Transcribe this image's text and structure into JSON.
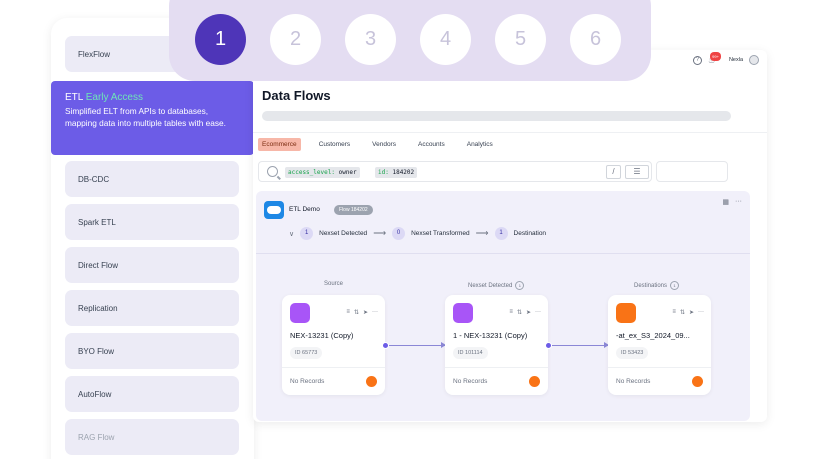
{
  "sidebar": {
    "items": [
      {
        "label": "FlexFlow"
      },
      {
        "label": "DB-CDC"
      },
      {
        "label": "Spark ETL"
      },
      {
        "label": "Direct Flow"
      },
      {
        "label": "Replication"
      },
      {
        "label": "BYO Flow"
      },
      {
        "label": "AutoFlow"
      },
      {
        "label": "RAG Flow"
      }
    ],
    "active": {
      "title": "ETL",
      "highlight": "Early Access",
      "description": "Simplified ELT from APIs to databases, mapping data into multiple tables with ease."
    }
  },
  "stepper": {
    "steps": [
      "1",
      "2",
      "3",
      "4",
      "5",
      "6"
    ],
    "active_index": 0
  },
  "topbar": {
    "user_name": "Nexla",
    "notification_count": "99+"
  },
  "page": {
    "title": "Data Flows",
    "tabs": [
      "Ecommerce",
      "Customers",
      "Vendors",
      "Accounts",
      "Analytics"
    ],
    "active_tab": "Ecommerce"
  },
  "search": {
    "chip1_key": "access_level:",
    "chip1_val": "owner",
    "chip2_key": "id:",
    "chip2_val": "184202",
    "slash": "/"
  },
  "flow": {
    "name": "ETL Demo",
    "badge": "Flow 184202",
    "stages": [
      {
        "count": "1",
        "label": "Nexset Detected"
      },
      {
        "count": "0",
        "label": "Nexset Transformed"
      },
      {
        "count": "1",
        "label": "Destination"
      }
    ],
    "columns": {
      "source": "Source",
      "nexset": "Nexset Detected",
      "nexset_count": "1",
      "destinations": "Destinations",
      "destinations_count": "1"
    },
    "nodes": [
      {
        "title": "NEX-13231 (Copy)",
        "id": "ID 65773",
        "status": "No Records",
        "color": "#a855f7"
      },
      {
        "title": "1 - NEX-13231 (Copy)",
        "id": "ID 101114",
        "status": "No Records",
        "color": "#a855f7"
      },
      {
        "title": "-at_ex_S3_2024_09...",
        "id": "ID 53423",
        "status": "No Records",
        "color": "#f97316"
      }
    ]
  },
  "colors": {
    "accent": "#6c5ce7",
    "stepper_active": "#4e35b8",
    "tab_active": "#f7b7a8"
  }
}
